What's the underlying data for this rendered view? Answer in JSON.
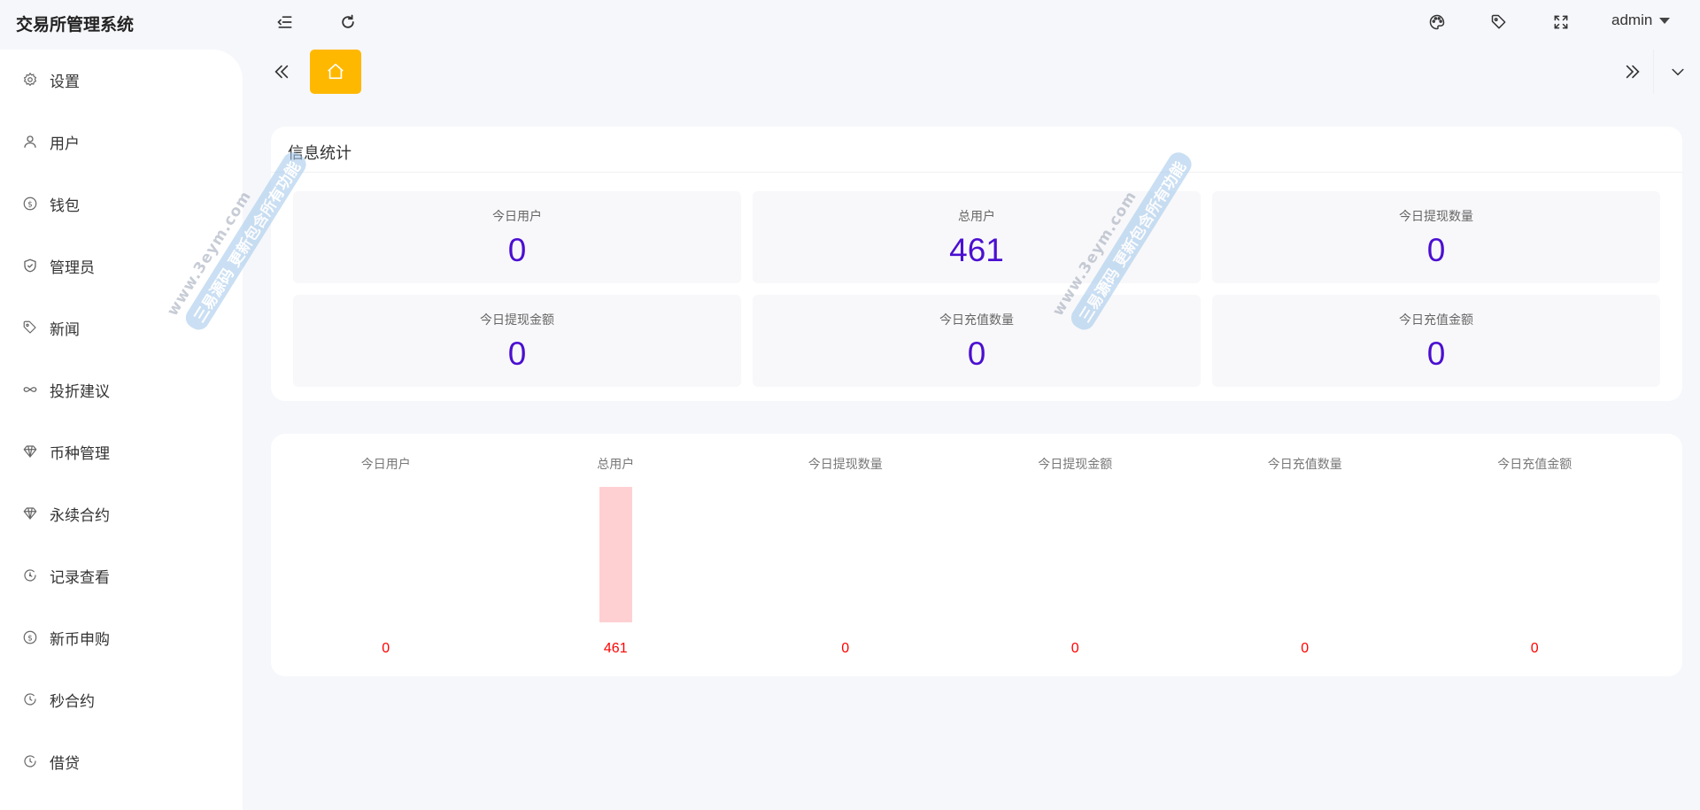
{
  "app": {
    "title": "交易所管理系统"
  },
  "toolbar": {
    "collapse_icon": "indent-icon",
    "refresh_icon": "refresh-icon",
    "theme_icon": "palette-icon",
    "tag_icon": "tag-icon",
    "fullscreen_icon": "fullscreen-icon",
    "user": "admin"
  },
  "sidebar": {
    "items": [
      {
        "label": "设置",
        "icon": "gear-icon"
      },
      {
        "label": "用户",
        "icon": "user-icon"
      },
      {
        "label": "钱包",
        "icon": "dollar-icon"
      },
      {
        "label": "管理员",
        "icon": "shield-icon"
      },
      {
        "label": "新闻",
        "icon": "tag-icon"
      },
      {
        "label": "投折建议",
        "icon": "infinity-icon"
      },
      {
        "label": "币种管理",
        "icon": "diamond-icon"
      },
      {
        "label": "永续合约",
        "icon": "diamond-icon"
      },
      {
        "label": "记录查看",
        "icon": "clock-arrow-icon"
      },
      {
        "label": "新币申购",
        "icon": "dollar-icon"
      },
      {
        "label": "秒合约",
        "icon": "clock-arrow-icon"
      },
      {
        "label": "借贷",
        "icon": "clock-arrow-icon"
      }
    ]
  },
  "tabs": {
    "home_icon": "home-icon"
  },
  "stats_card": {
    "title": "信息统计",
    "items": [
      {
        "label": "今日用户",
        "value": "0"
      },
      {
        "label": "总用户",
        "value": "461"
      },
      {
        "label": "今日提现数量",
        "value": "0"
      },
      {
        "label": "今日提现金额",
        "value": "0"
      },
      {
        "label": "今日充值数量",
        "value": "0"
      },
      {
        "label": "今日充值金额",
        "value": "0"
      }
    ]
  },
  "chart_data": {
    "type": "bar",
    "categories": [
      "今日用户",
      "总用户",
      "今日提现数量",
      "今日提现金额",
      "今日充值数量",
      "今日充值金额"
    ],
    "values": [
      0,
      461,
      0,
      0,
      0,
      0
    ],
    "data_labels": [
      "0",
      "461",
      "0",
      "0",
      "0",
      "0"
    ],
    "title": "",
    "xlabel": "",
    "ylabel": "",
    "ylim": [
      0,
      461
    ],
    "bar_color": "#ffd0d2",
    "label_color": "#ff0000",
    "grid": false
  },
  "watermark": {
    "line1": "www.3eym.com",
    "line2": "三易源码 更新包含所有功能"
  },
  "colors": {
    "accent": "#ffb800",
    "stat_value": "#4b0fd1"
  }
}
